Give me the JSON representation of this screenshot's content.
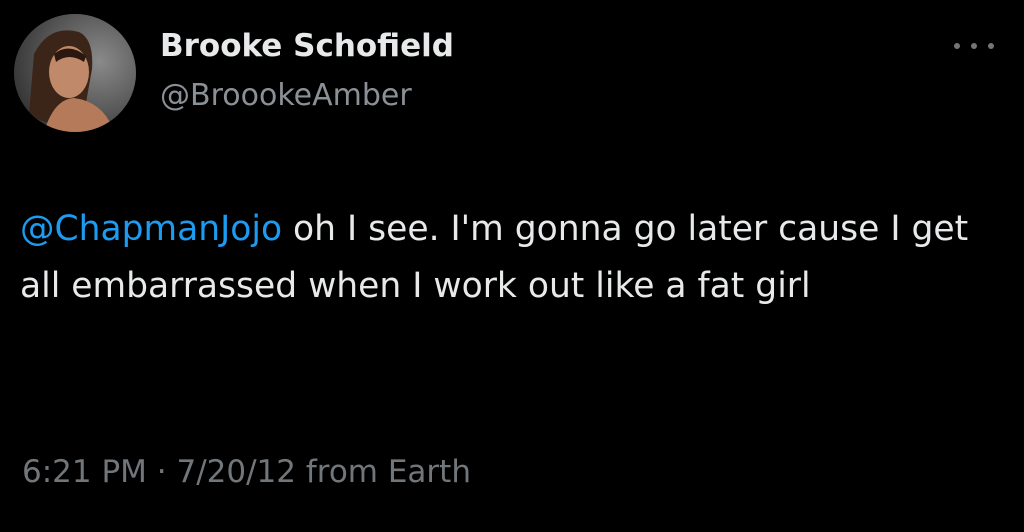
{
  "author": {
    "display_name": "Brooke Schofield",
    "handle": "@BroookeAmber"
  },
  "tweet": {
    "mention": "@ChapmanJojo",
    "text": " oh I see. I'm gonna go later cause I get all embarrassed when I work out like a fat girl"
  },
  "meta": {
    "time": "6:21 PM",
    "separator": " · ",
    "date": "7/20/12",
    "source": " from Earth"
  },
  "icons": {
    "more": "more-horizontal-icon",
    "avatar": "profile-photo"
  },
  "colors": {
    "background": "#000000",
    "text": "#e7e9ea",
    "secondary": "#71767b",
    "link": "#1d9bf0"
  }
}
